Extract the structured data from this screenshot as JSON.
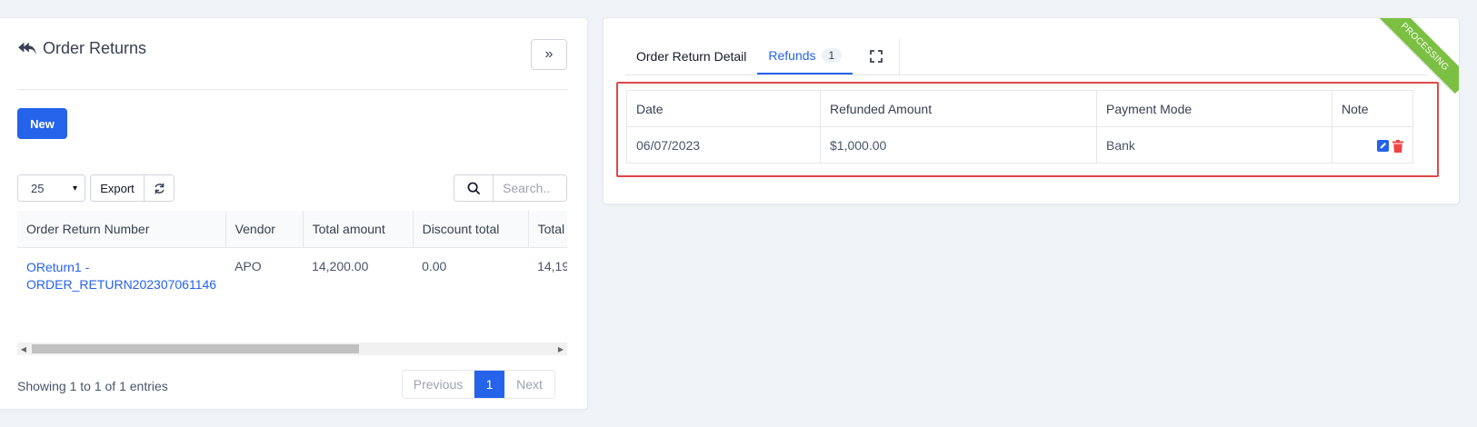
{
  "left": {
    "title": "Order Returns",
    "new_label": "New",
    "page_length": "25",
    "export_label": "Export",
    "search_placeholder": "Search..",
    "columns": [
      "Order Return Number",
      "Vendor",
      "Total amount",
      "Discount total",
      "Total"
    ],
    "rows": [
      {
        "number_line1": "OReturn1 -",
        "number_line2": "ORDER_RETURN202307061146",
        "vendor": "APO",
        "total_amount": "14,200.00",
        "discount_total": "0.00",
        "total": "14,19"
      }
    ],
    "info": "Showing 1 to 1 of 1 entries",
    "pager": {
      "prev": "Previous",
      "page": "1",
      "next": "Next"
    }
  },
  "right": {
    "tabs": [
      {
        "label": "Order Return Detail"
      },
      {
        "label": "Refunds",
        "badge": "1"
      }
    ],
    "ribbon": "PROCESSING",
    "refunds": {
      "columns": [
        "Date",
        "Refunded Amount",
        "Payment Mode",
        "Note"
      ],
      "rows": [
        {
          "date": "06/07/2023",
          "amount": "$1,000.00",
          "mode": "Bank",
          "note": ""
        }
      ]
    }
  },
  "colors": {
    "primary": "#2563eb",
    "ribbon": "#7bc043",
    "highlight": "#e04848",
    "delete": "#ef4444"
  }
}
